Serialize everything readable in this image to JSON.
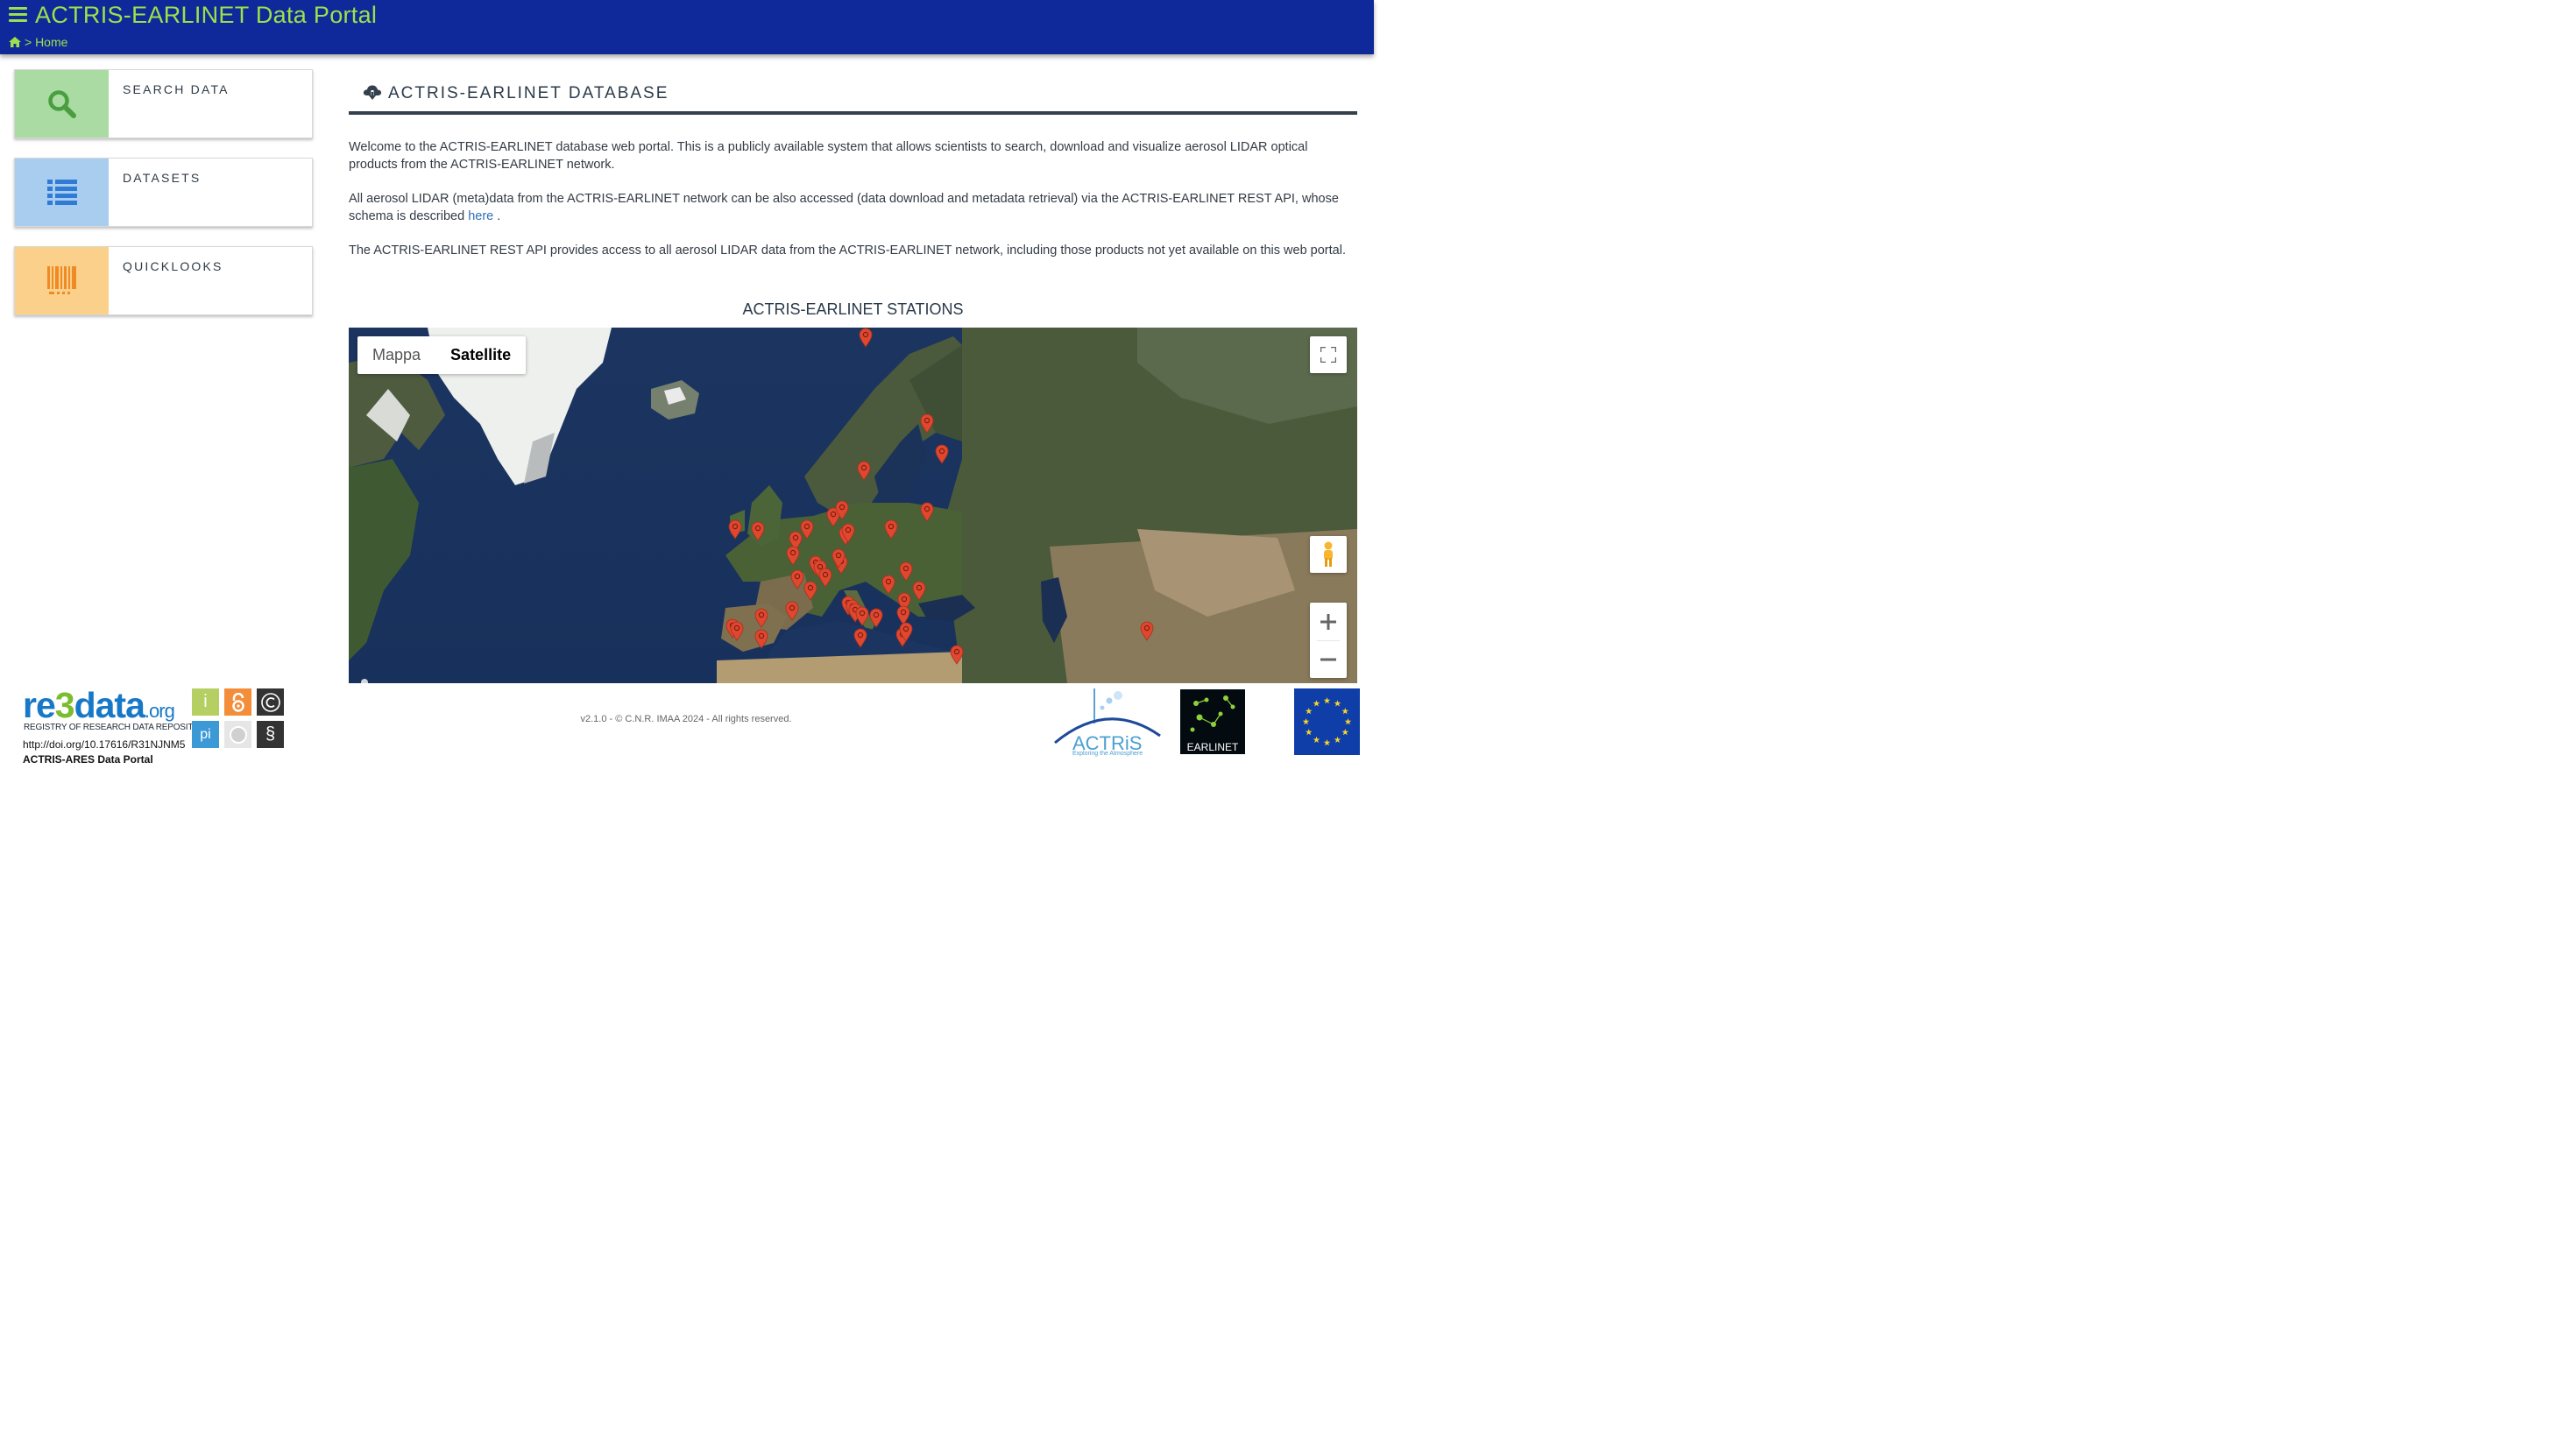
{
  "header": {
    "title": "ACTRIS-EARLINET Data Portal",
    "breadcrumb": "> Home",
    "bg_color": "#10299a",
    "accent_color": "#9fe04a"
  },
  "sidebar": {
    "cards": [
      {
        "label": "SEARCH DATA",
        "icon": "search-icon",
        "color": "#a9dba3"
      },
      {
        "label": "DATASETS",
        "icon": "list-icon",
        "color": "#a8cdef"
      },
      {
        "label": "QUICKLOOKS",
        "icon": "barcode-icon",
        "color": "#fbd08a"
      }
    ]
  },
  "main": {
    "section_title": "ACTRIS-EARLINET DATABASE",
    "paragraph1": "Welcome to the ACTRIS-EARLINET database web portal. This is a publicly available system that allows scientists to search, download and visualize aerosol LIDAR optical products from the ACTRIS-EARLINET network.",
    "paragraph2_before": "All aerosol LIDAR (meta)data from the ACTRIS-EARLINET network can be also accessed (data download and metadata retrieval) via the ACTRIS-EARLINET REST API, whose schema is described ",
    "paragraph2_link": "here",
    "paragraph2_after": " .",
    "paragraph3": "The ACTRIS-EARLINET REST API provides access to all aerosol LIDAR data from the ACTRIS-EARLINET network, including those products not yet available on this web portal.",
    "stations_title": "ACTRIS-EARLINET STATIONS"
  },
  "map": {
    "type_buttons": [
      {
        "label": "Mappa",
        "active": false
      },
      {
        "label": "Satellite",
        "active": true
      }
    ],
    "marker_color": "#e0472f",
    "controls": [
      "fullscreen-icon",
      "pegman-icon",
      "zoom-in-icon",
      "zoom-out-icon"
    ]
  },
  "footer": {
    "version": "v2.1.0 - © C.N.R. IMAA 2024 - All rights reserved.",
    "re3data": {
      "logo_re": "re",
      "logo_3": "3",
      "logo_data": "data",
      "logo_org": ".org",
      "tagline": "REGISTRY OF RESEARCH DATA REPOSITORIES",
      "doi": "http://doi.org/10.17616/R31NJNM5",
      "portal": "ACTRIS-ARES Data Portal"
    },
    "actris": {
      "name": "ACTRiS",
      "tagline": "Exploring the Atmosphere"
    },
    "earlinet": {
      "name": "EARLINET"
    }
  }
}
